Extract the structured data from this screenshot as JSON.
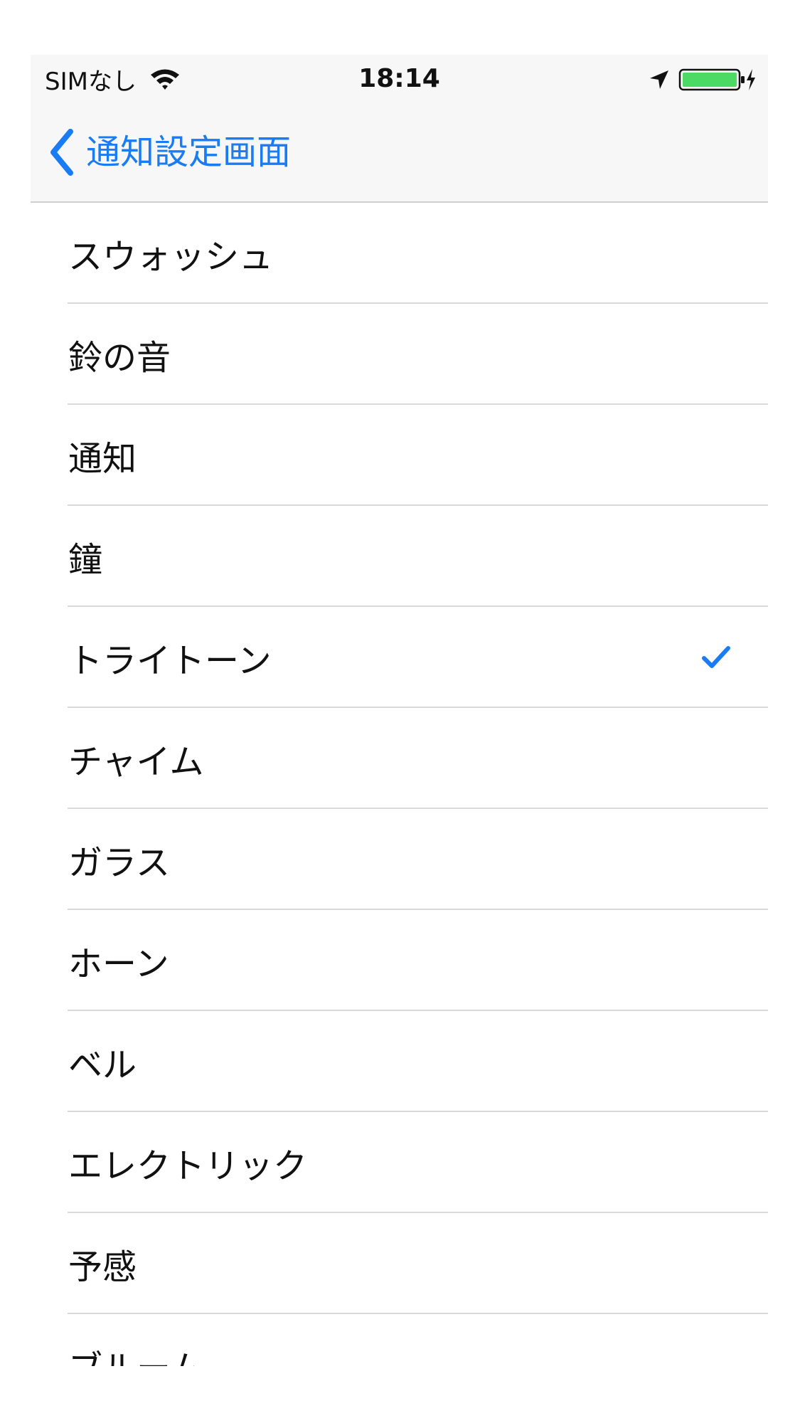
{
  "status_bar": {
    "carrier": "SIMなし",
    "time": "18:14",
    "wifi_icon": "wifi-icon",
    "location_icon": "location-arrow-icon",
    "battery_icon": "battery-full-charging-icon",
    "battery_color": "#4cd964"
  },
  "nav": {
    "back_label": "通知設定画面",
    "back_icon": "chevron-left-icon",
    "accent_color": "#1a7cf5"
  },
  "list": {
    "items": [
      {
        "label": "スウォッシュ",
        "selected": false
      },
      {
        "label": "鈴の音",
        "selected": false
      },
      {
        "label": "通知",
        "selected": false
      },
      {
        "label": "鐘",
        "selected": false
      },
      {
        "label": "トライトーン",
        "selected": true
      },
      {
        "label": "チャイム",
        "selected": false
      },
      {
        "label": "ガラス",
        "selected": false
      },
      {
        "label": "ホーン",
        "selected": false
      },
      {
        "label": "ベル",
        "selected": false
      },
      {
        "label": "エレクトリック",
        "selected": false
      },
      {
        "label": "予感",
        "selected": false
      },
      {
        "label": "ブルーム",
        "selected": false
      }
    ],
    "check_icon": "checkmark-icon"
  }
}
